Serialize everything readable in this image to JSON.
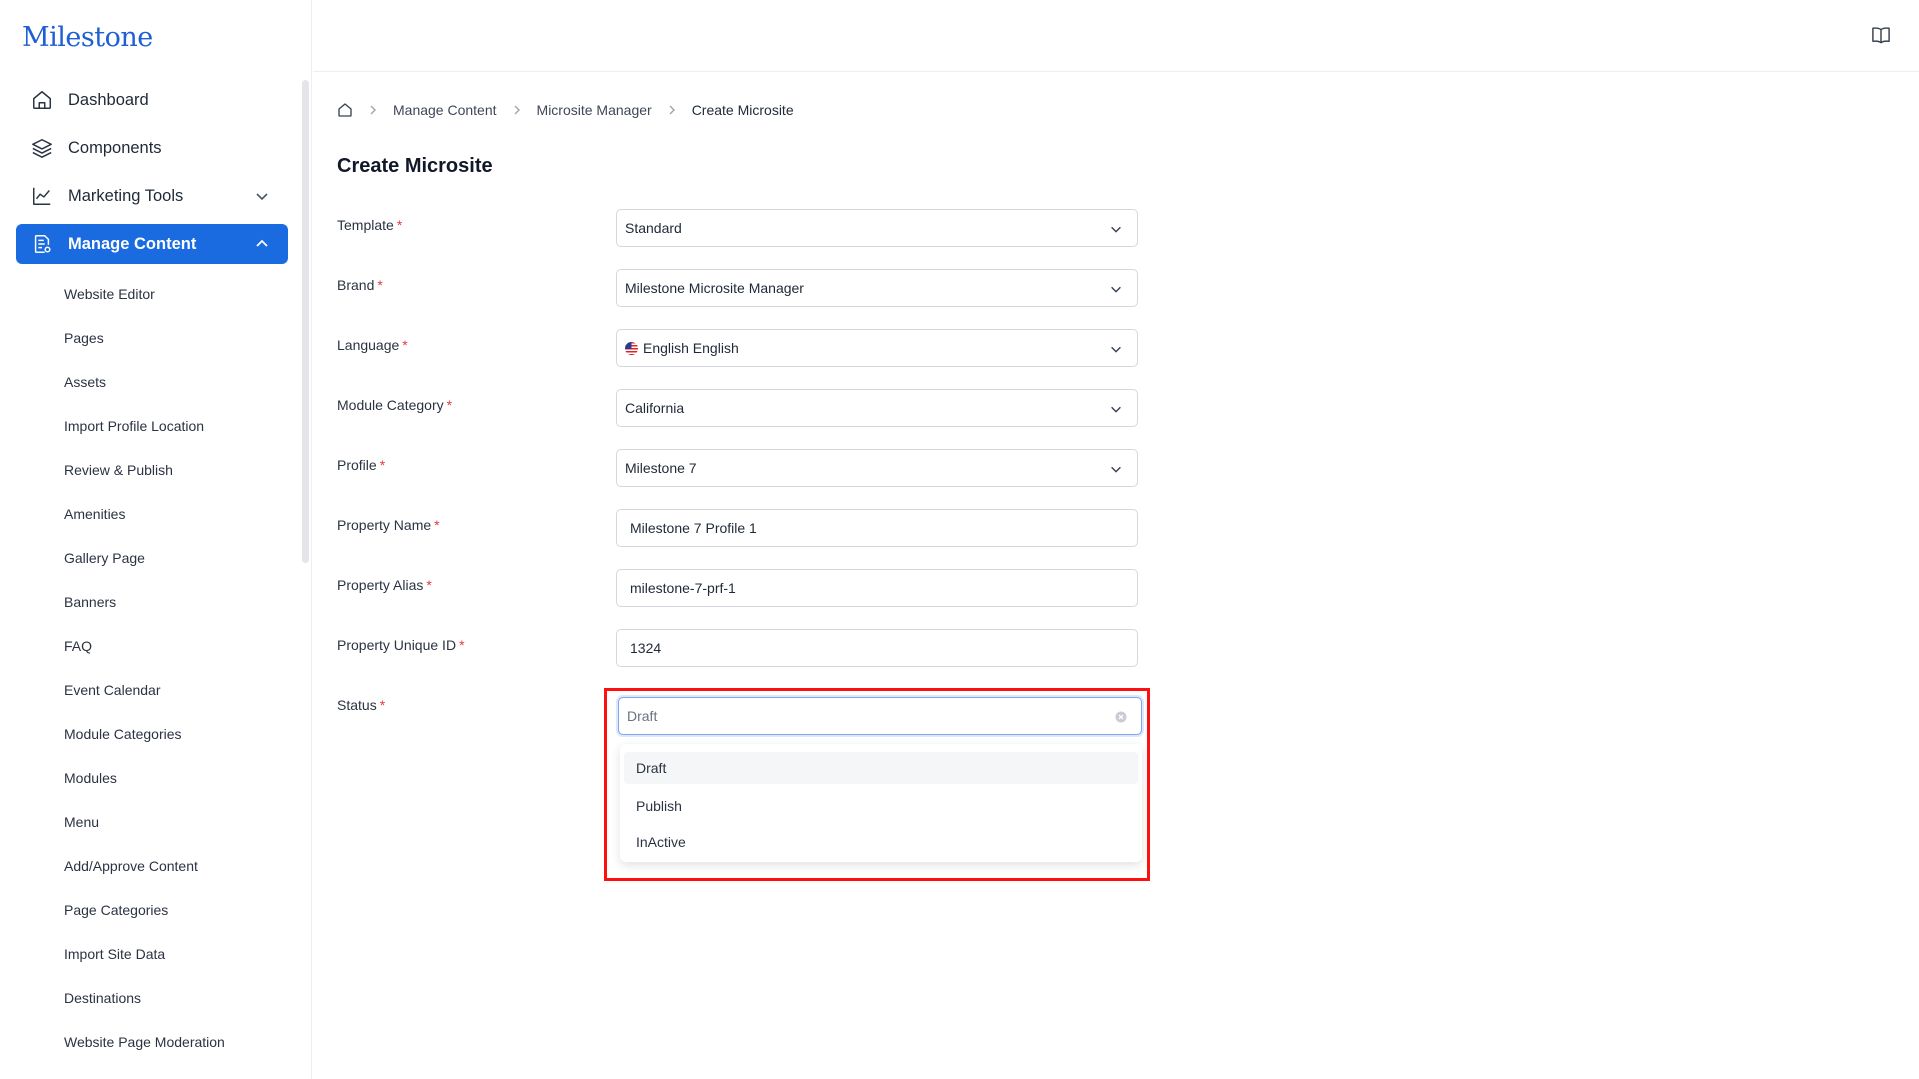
{
  "app": {
    "logo": "Milestone"
  },
  "sidebar": {
    "items": [
      {
        "label": "Dashboard",
        "icon": "home-icon"
      },
      {
        "label": "Components",
        "icon": "layers-icon"
      },
      {
        "label": "Marketing Tools",
        "icon": "chart-line-icon",
        "expandable": true
      },
      {
        "label": "Manage Content",
        "icon": "document-settings-icon",
        "active": true,
        "expanded": true
      }
    ],
    "sub_items": [
      "Website Editor",
      "Pages",
      "Assets",
      "Import Profile Location",
      "Review & Publish",
      "Amenities",
      "Gallery Page",
      "Banners",
      "FAQ",
      "Event Calendar",
      "Module Categories",
      "Modules",
      "Menu",
      "Add/Approve Content",
      "Page Categories",
      "Import Site Data",
      "Destinations",
      "Website Page Moderation"
    ]
  },
  "topbar": {
    "icon": "book-icon"
  },
  "breadcrumb": {
    "home_icon": "home-icon",
    "items": [
      "Manage Content",
      "Microsite Manager",
      "Create Microsite"
    ]
  },
  "page": {
    "title": "Create Microsite"
  },
  "form": {
    "fields": [
      {
        "label": "Template",
        "value": "Standard",
        "type": "select"
      },
      {
        "label": "Brand",
        "value": "Milestone Microsite Manager",
        "type": "select"
      },
      {
        "label": "Language",
        "value": "English English",
        "type": "select",
        "flag": "us-flag-icon"
      },
      {
        "label": "Module Category",
        "value": "California",
        "type": "select"
      },
      {
        "label": "Profile",
        "value": "Milestone 7",
        "type": "select"
      },
      {
        "label": "Property Name",
        "value": "Milestone 7 Profile 1",
        "type": "input"
      },
      {
        "label": "Property Alias",
        "value": "milestone-7-prf-1",
        "type": "input"
      },
      {
        "label": "Property Unique ID",
        "value": "1324",
        "type": "input"
      }
    ],
    "status": {
      "label": "Status",
      "value": "Draft",
      "options": [
        "Draft",
        "Publish",
        "InActive"
      ]
    },
    "required_mark": "*"
  },
  "colors": {
    "accent": "#1a6be0",
    "required": "#e23b3b",
    "highlight": "#ff1010"
  }
}
